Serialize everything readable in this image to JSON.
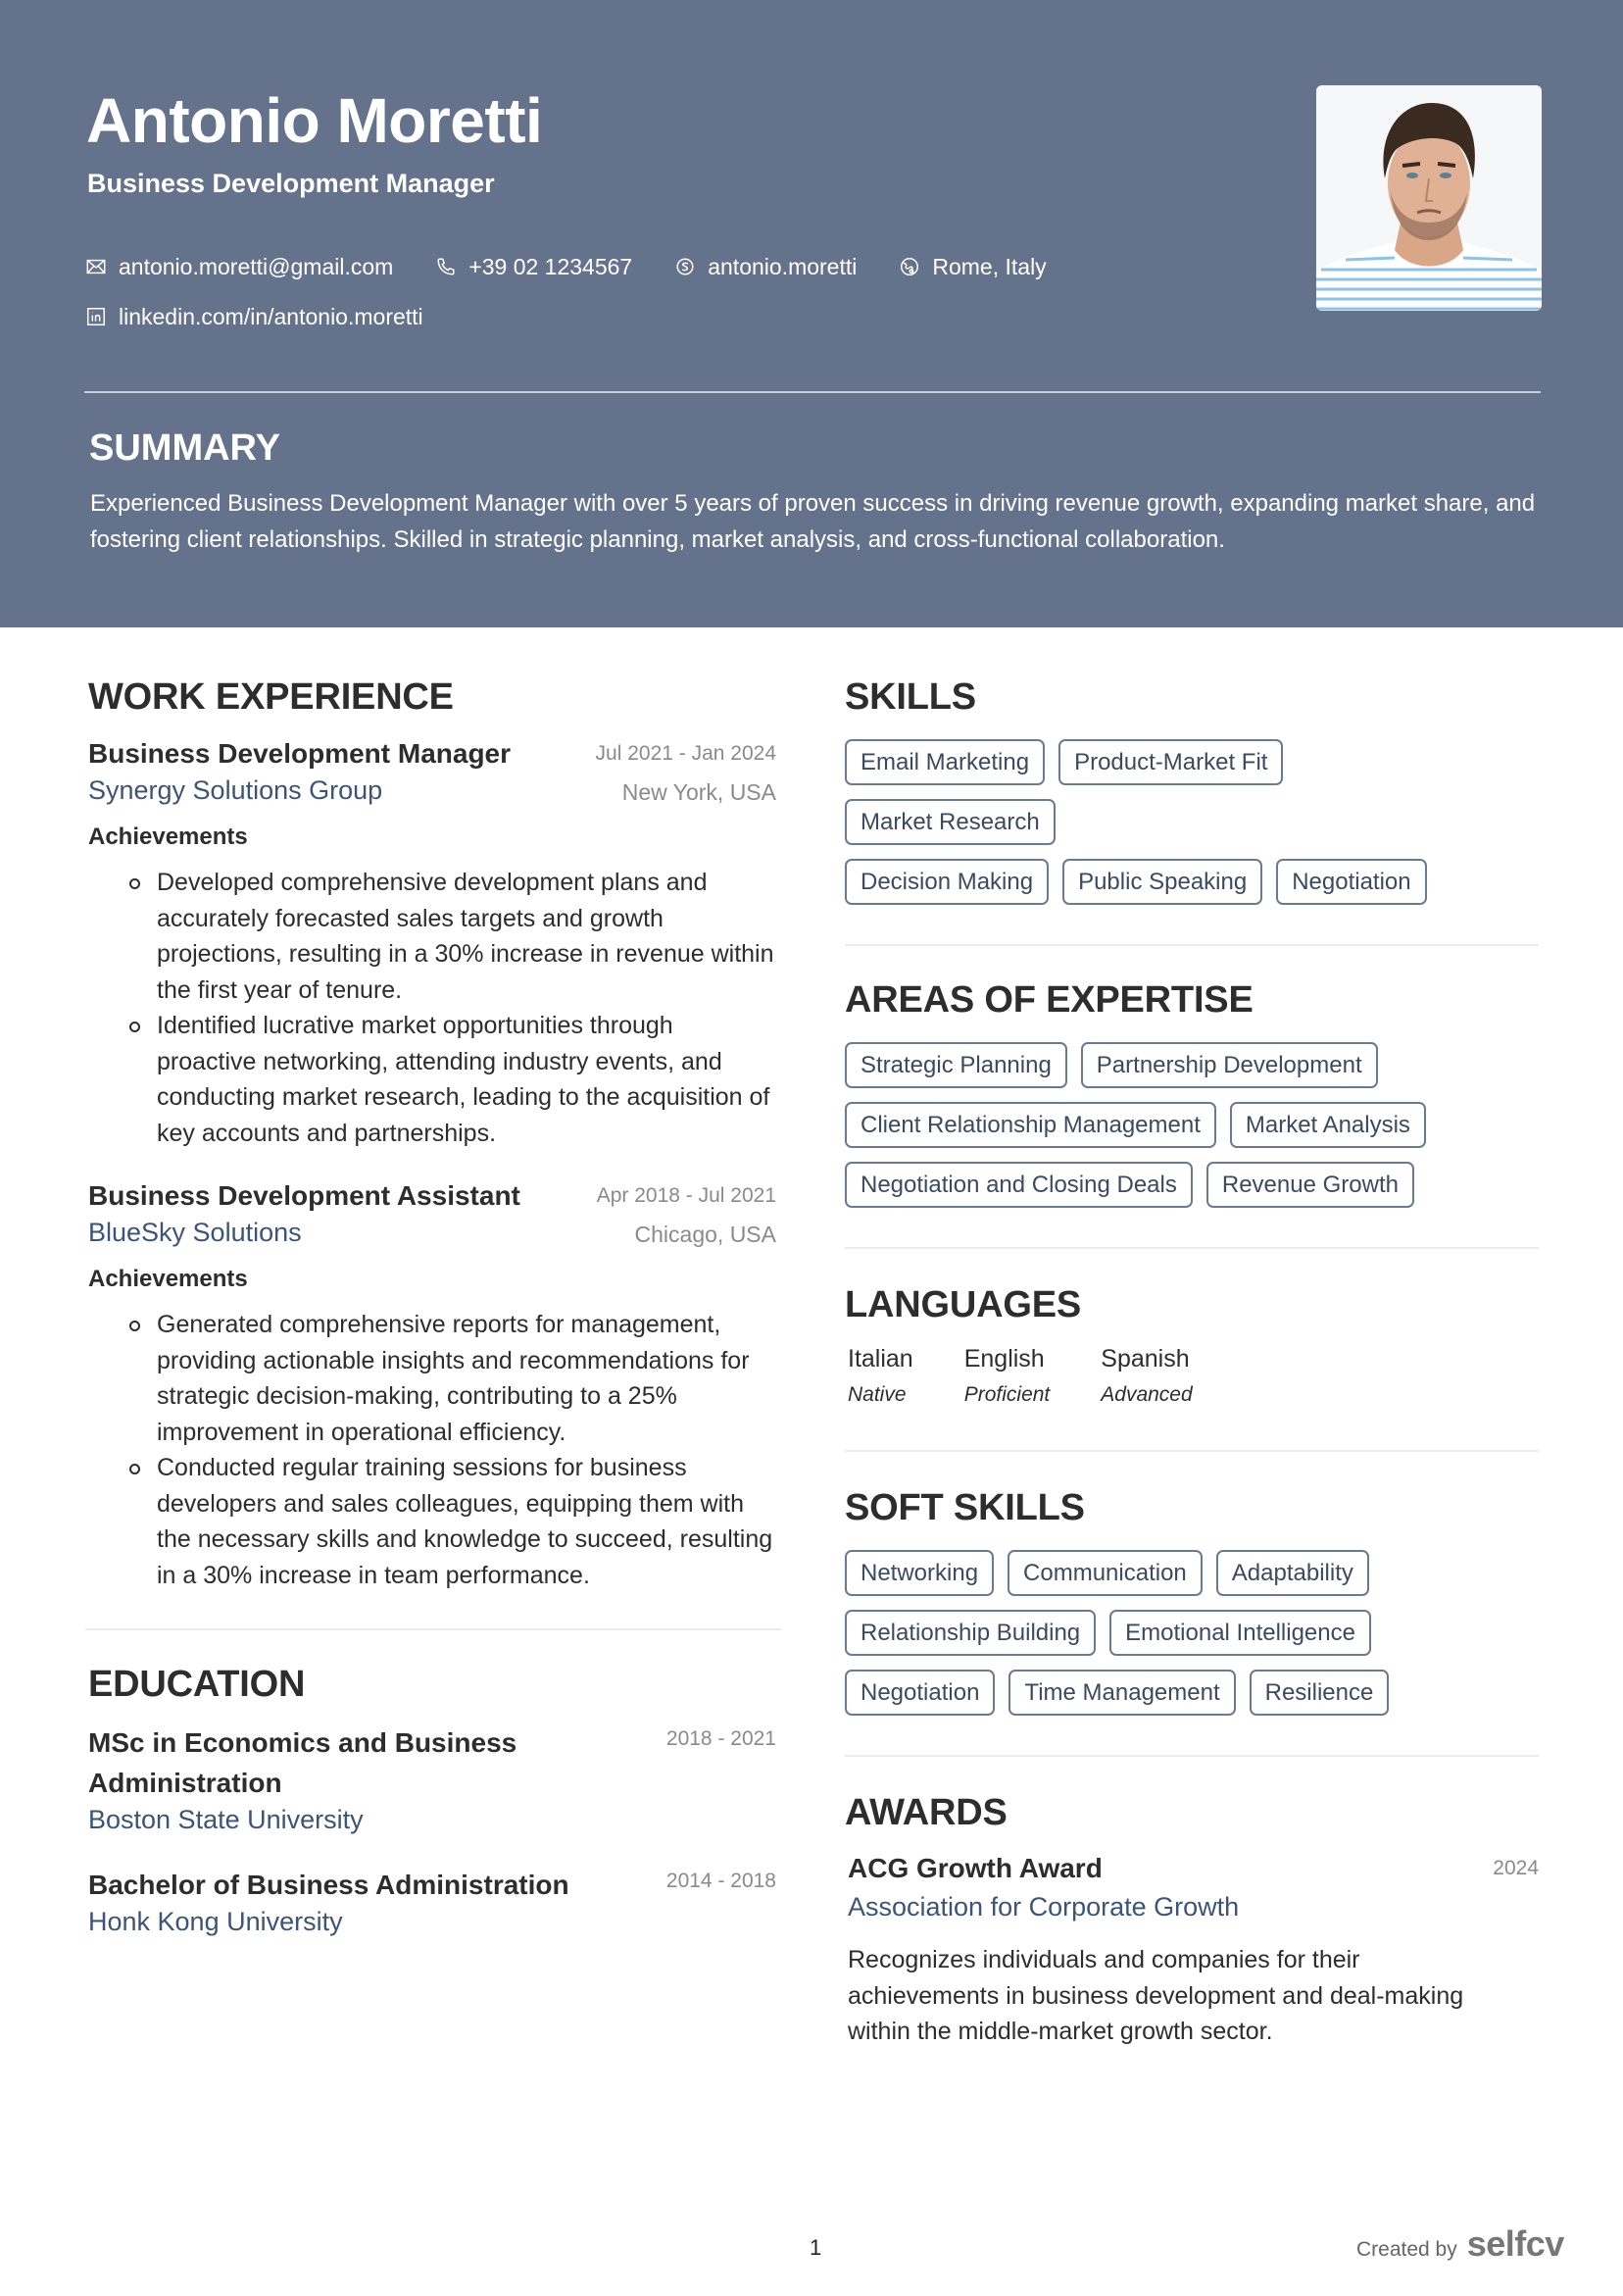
{
  "header": {
    "name": "Antonio Moretti",
    "title": "Business Development Manager",
    "contacts": [
      {
        "icon": "envelope-icon",
        "text": "antonio.moretti@gmail.com"
      },
      {
        "icon": "phone-icon",
        "text": "+39 02 1234567"
      },
      {
        "icon": "skype-icon",
        "text": "antonio.moretti"
      },
      {
        "icon": "location-icon",
        "text": "Rome, Italy"
      },
      {
        "icon": "linkedin-icon",
        "text": "linkedin.com/in/antonio.moretti"
      }
    ]
  },
  "summary": {
    "title": "SUMMARY",
    "text": "Experienced Business Development Manager with over 5 years of proven success in driving revenue growth, expanding market share, and fostering client relationships. Skilled in strategic planning, market analysis, and cross-functional collaboration."
  },
  "work": {
    "title": "WORK EXPERIENCE",
    "jobs": [
      {
        "role": "Business Development Manager",
        "dates": "Jul 2021 - Jan 2024",
        "company": "Synergy Solutions Group",
        "location": "New York, USA",
        "achievements_label": "Achievements",
        "bullets": [
          "Developed comprehensive development plans and accurately forecasted sales targets and growth projections, resulting in a 30% increase in revenue within the first year of tenure.",
          "Identified lucrative market opportunities through proactive networking, attending industry events, and conducting market research, leading to the acquisition of key accounts and partnerships."
        ]
      },
      {
        "role": "Business Development Assistant",
        "dates": "Apr 2018 - Jul 2021",
        "company": "BlueSky Solutions",
        "location": "Chicago, USA",
        "achievements_label": "Achievements",
        "bullets": [
          "Generated comprehensive reports for management, providing actionable insights and recommendations for strategic decision-making, contributing to a 25% improvement in operational efficiency.",
          "Conducted regular training sessions for business developers and sales colleagues, equipping them with the necessary skills and knowledge to succeed, resulting in a 30% increase in team performance."
        ]
      }
    ]
  },
  "education": {
    "title": "EDUCATION",
    "items": [
      {
        "degree": "MSc in Economics and Business Administration",
        "dates": "2018 - 2021",
        "school": "Boston State University"
      },
      {
        "degree": "Bachelor of Business Administration",
        "dates": "2014 - 2018",
        "school": "Honk Kong University"
      }
    ]
  },
  "skills": {
    "title": "SKILLS",
    "items": [
      "Email Marketing",
      "Product-Market Fit",
      "Market Research",
      "Decision Making",
      "Public Speaking",
      "Negotiation"
    ]
  },
  "expertise": {
    "title": "AREAS OF EXPERTISE",
    "items": [
      "Strategic Planning",
      "Partnership Development",
      "Client Relationship Management",
      "Market Analysis",
      "Negotiation and Closing Deals",
      "Revenue Growth"
    ]
  },
  "languages": {
    "title": "LANGUAGES",
    "items": [
      {
        "name": "Italian",
        "level": "Native"
      },
      {
        "name": "English",
        "level": "Proficient"
      },
      {
        "name": "Spanish",
        "level": "Advanced"
      }
    ]
  },
  "soft_skills": {
    "title": "SOFT SKILLS",
    "items": [
      "Networking",
      "Communication",
      "Adaptability",
      "Relationship Building",
      "Emotional Intelligence",
      "Negotiation",
      "Time Management",
      "Resilience"
    ]
  },
  "awards": {
    "title": "AWARDS",
    "items": [
      {
        "title": "ACG Growth Award",
        "year": "2024",
        "org": "Association for Corporate Growth",
        "description": "Recognizes individuals and companies for their achievements in business development and deal-making within the middle-market growth sector."
      }
    ]
  },
  "footer": {
    "page_number": "1",
    "created_by": "Created by",
    "brand": "selfcv"
  },
  "colors": {
    "header_bg": "#64738b",
    "accent_text": "#3c5476",
    "tag_border": "#6b7a92"
  }
}
